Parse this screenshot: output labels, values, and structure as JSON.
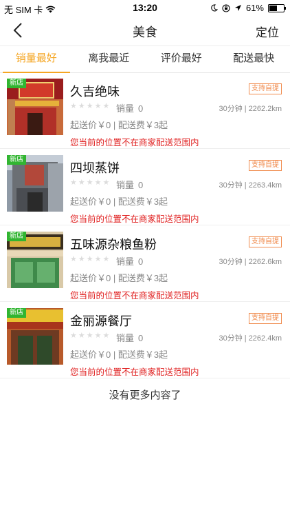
{
  "status_bar": {
    "carrier": "无 SIM 卡",
    "time": "13:20",
    "battery": "61%",
    "battery_level": 0.61
  },
  "nav": {
    "title": "美食",
    "right_action": "定位"
  },
  "tabs": [
    {
      "label": "销量最好",
      "active": true
    },
    {
      "label": "离我最近",
      "active": false
    },
    {
      "label": "评价最好",
      "active": false
    },
    {
      "label": "配送最快",
      "active": false
    }
  ],
  "shops": [
    {
      "name": "久吉绝味",
      "badge": "新店",
      "pickup": "支持自提",
      "sales_label": "销量",
      "sales": "0",
      "time_distance": "30分钟 | 2262.2km",
      "fees": "起送价￥0 | 配送费￥3起",
      "warning": "您当前的位置不在商家配送范围内",
      "rating": 0
    },
    {
      "name": "四坝蒸饼",
      "badge": "新店",
      "pickup": "支持自提",
      "sales_label": "销量",
      "sales": "0",
      "time_distance": "30分钟 | 2263.4km",
      "fees": "起送价￥0 | 配送费￥3起",
      "warning": "您当前的位置不在商家配送范围内",
      "rating": 0
    },
    {
      "name": "五味源杂粮鱼粉",
      "badge": "新店",
      "pickup": "支持自提",
      "sales_label": "销量",
      "sales": "0",
      "time_distance": "30分钟 | 2262.6km",
      "fees": "起送价￥0 | 配送费￥3起",
      "warning": "您当前的位置不在商家配送范围内",
      "rating": 0
    },
    {
      "name": "金丽源餐厅",
      "badge": "新店",
      "pickup": "支持自提",
      "sales_label": "销量",
      "sales": "0",
      "time_distance": "30分钟 | 2262.4km",
      "fees": "起送价￥0 | 配送费￥3起",
      "warning": "您当前的位置不在商家配送范围内",
      "rating": 0
    }
  ],
  "footer": {
    "no_more": "没有更多内容了"
  },
  "colors": {
    "accent": "#f5a623",
    "new_badge": "#31b531",
    "pickup_badge": "#f08a4b",
    "warning": "#e02020"
  }
}
